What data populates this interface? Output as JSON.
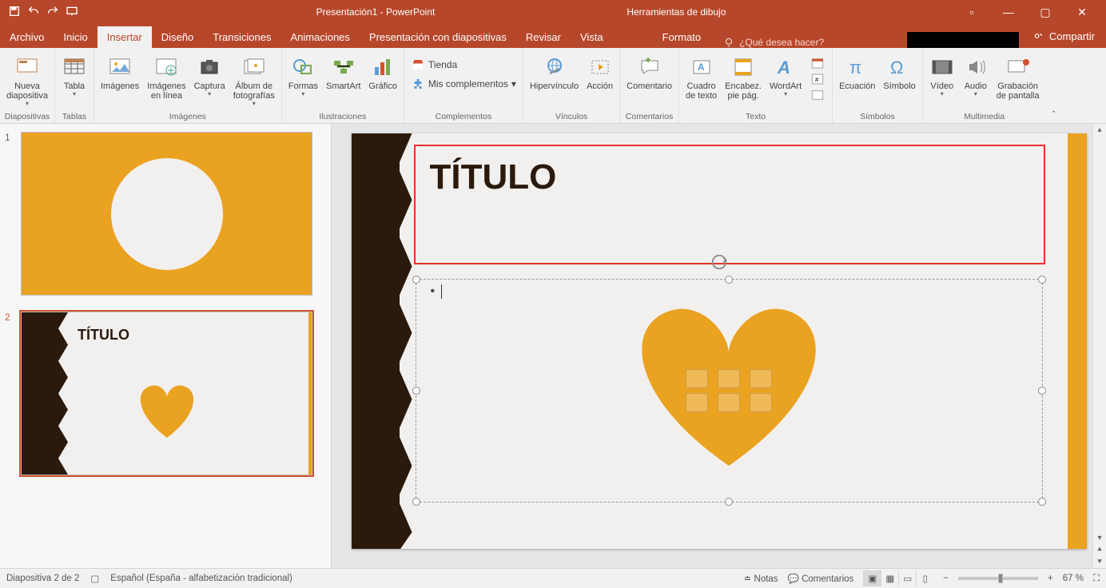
{
  "titlebar": {
    "doc_title": "Presentación1 - PowerPoint",
    "context_tab": "Herramientas de dibujo"
  },
  "tabs": {
    "archivo": "Archivo",
    "inicio": "Inicio",
    "insertar": "Insertar",
    "diseno": "Diseño",
    "transiciones": "Transiciones",
    "animaciones": "Animaciones",
    "presentacion": "Presentación con diapositivas",
    "revisar": "Revisar",
    "vista": "Vista",
    "formato": "Formato",
    "tell_me": "¿Qué desea hacer?",
    "compartir": "Compartir"
  },
  "ribbon": {
    "diapositivas": {
      "label": "Diapositivas",
      "nueva": "Nueva\ndiapositiva"
    },
    "tablas": {
      "label": "Tablas",
      "tabla": "Tabla"
    },
    "imagenes": {
      "label": "Imágenes",
      "imagenes": "Imágenes",
      "enlinea": "Imágenes\nen línea",
      "captura": "Captura",
      "album": "Álbum de\nfotografías"
    },
    "ilustraciones": {
      "label": "Ilustraciones",
      "formas": "Formas",
      "smartart": "SmartArt",
      "grafico": "Gráfico"
    },
    "complementos": {
      "label": "Complementos",
      "tienda": "Tienda",
      "mis": "Mis complementos"
    },
    "vinculos": {
      "label": "Vínculos",
      "hiper": "Hipervínculo",
      "accion": "Acción"
    },
    "comentarios": {
      "label": "Comentarios",
      "comentario": "Comentario"
    },
    "texto": {
      "label": "Texto",
      "cuadro": "Cuadro\nde texto",
      "encabez": "Encabez.\npie pág.",
      "wordart": "WordArt"
    },
    "simbolos": {
      "label": "Símbolos",
      "ecuacion": "Ecuación",
      "simbolo": "Símbolo"
    },
    "multimedia": {
      "label": "Multimedia",
      "video": "Vídeo",
      "audio": "Audio",
      "grab": "Grabación\nde pantalla"
    }
  },
  "slide": {
    "title": "TÍTULO",
    "thumb_title": "TÍTULO"
  },
  "statusbar": {
    "slide_n": "Diapositiva 2 de 2",
    "lang": "Español (España - alfabetización tradicional)",
    "notas": "Notas",
    "comentarios": "Comentarios",
    "zoom": "67 %"
  }
}
